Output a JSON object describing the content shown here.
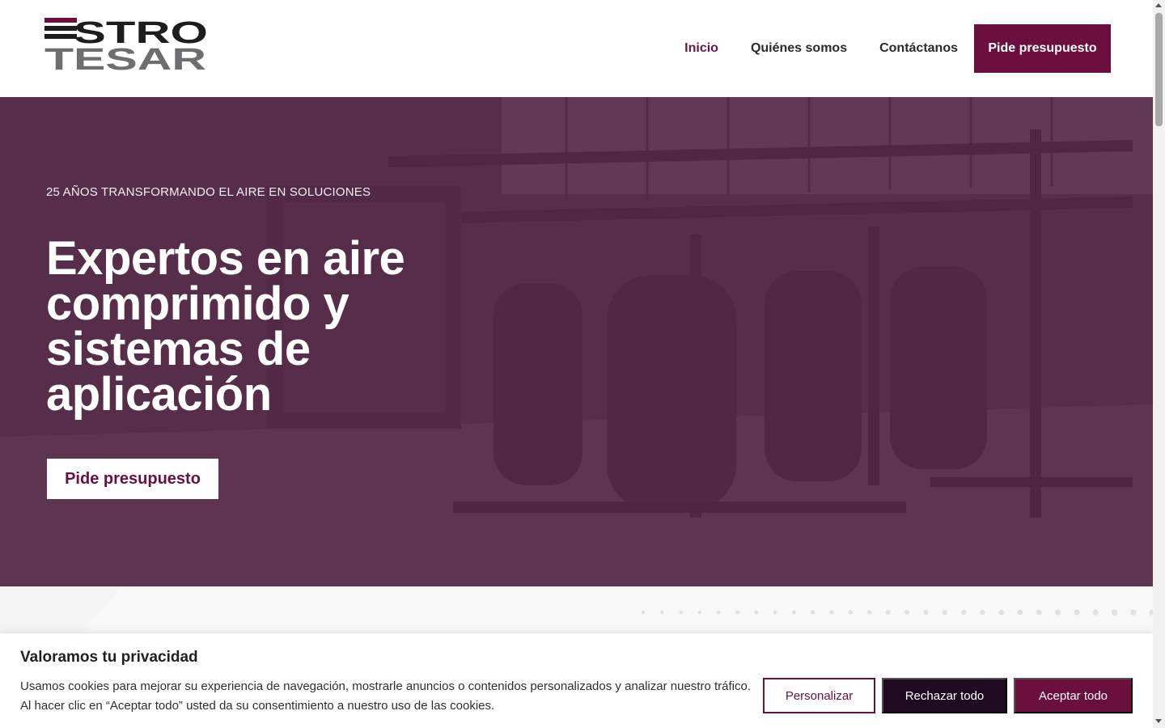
{
  "logo": {
    "line1": "STRO",
    "line2": "TESAR",
    "alt": "Estro Tesar"
  },
  "nav": {
    "items": [
      {
        "label": "Inicio",
        "active": true
      },
      {
        "label": "Quiénes somos",
        "active": false
      },
      {
        "label": "Contáctanos",
        "active": false
      }
    ],
    "cta_label": "Pide presupuesto"
  },
  "hero": {
    "eyebrow": "25 AÑOS TRANSFORMANDO EL AIRE EN SOLUCIONES",
    "title": "Expertos en aire comprimido y sistemas de aplicación",
    "button_label": "Pide presupuesto"
  },
  "cookie": {
    "title": "Valoramos tu privacidad",
    "text": "Usamos cookies para mejorar su experiencia de navegación, mostrarle anuncios o contenidos personalizados y analizar nuestro tráfico. Al hacer clic en “Aceptar todo” usted da su consentimiento a nuestro uso de las cookies.",
    "customize_label": "Personalizar",
    "reject_label": "Rechazar todo",
    "accept_label": "Aceptar todo"
  },
  "colors": {
    "brand": "#6b0f3f",
    "dark": "#1f0a22",
    "hero_overlay": "#562646"
  }
}
